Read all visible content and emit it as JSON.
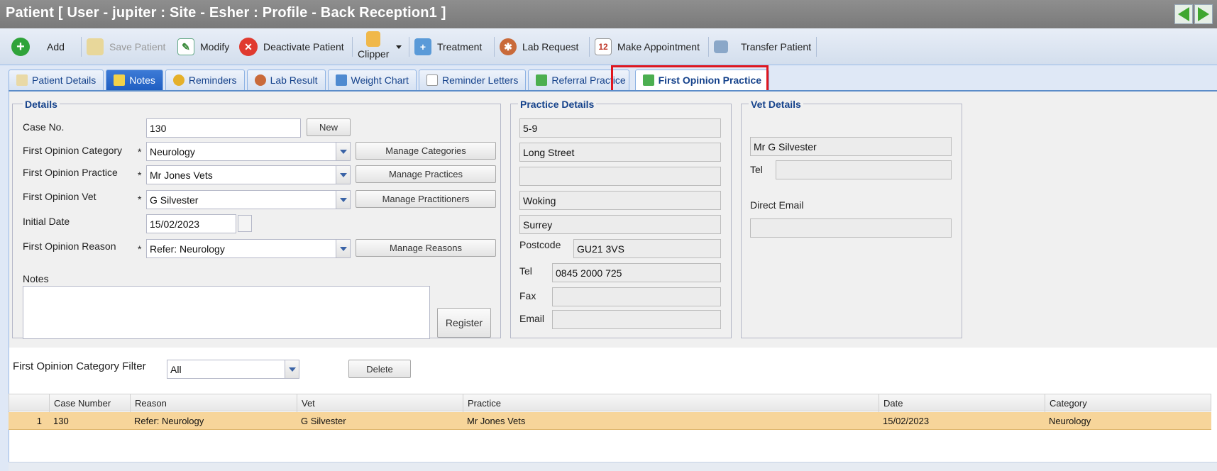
{
  "window": {
    "title": "Patient [ User - jupiter : Site - Esher : Profile - Back Reception1 ]"
  },
  "toolbar": {
    "add": "Add",
    "save": "Save Patient",
    "modify": "Modify",
    "deactivate": "Deactivate Patient",
    "clipper": "Clipper",
    "treatment": "Treatment",
    "lab_request": "Lab Request",
    "make_appointment": "Make Appointment",
    "calendar_day": "12",
    "transfer": "Transfer Patient"
  },
  "tabs": [
    "Patient Details",
    "Notes",
    "Reminders",
    "Lab Result",
    "Weight Chart",
    "Reminder Letters",
    "Referral Practice",
    "First Opinion Practice"
  ],
  "details": {
    "legend": "Details",
    "case_no_label": "Case No.",
    "case_no": "130",
    "new_button": "New",
    "category_label": "First Opinion Category",
    "category": "Neurology",
    "manage_categories": "Manage Categories",
    "practice_label": "First Opinion Practice",
    "practice": "Mr Jones Vets",
    "manage_practices": "Manage Practices",
    "vet_label": "First Opinion Vet",
    "vet": "G Silvester",
    "manage_practitioners": "Manage Practitioners",
    "initial_date_label": "Initial Date",
    "initial_date": "15/02/2023",
    "reason_label": "First Opinion Reason",
    "reason": "Refer: Neurology",
    "manage_reasons": "Manage Reasons",
    "notes_label": "Notes",
    "register_button": "Register",
    "required_mark": "*"
  },
  "practice_details": {
    "legend": "Practice Details",
    "line1": "5-9",
    "line2": "Long Street",
    "line3": "",
    "town": "Woking",
    "county": "Surrey",
    "postcode_label": "Postcode",
    "postcode": "GU21 3VS",
    "tel_label": "Tel",
    "tel": "0845 2000 725",
    "fax_label": "Fax",
    "fax": "",
    "email_label": "Email",
    "email": ""
  },
  "vet_details": {
    "legend": "Vet Details",
    "name": "Mr G Silvester",
    "tel_label": "Tel",
    "tel": "",
    "email_label": "Direct Email",
    "email": ""
  },
  "filter": {
    "label": "First Opinion Category Filter",
    "value": "All",
    "delete_button": "Delete"
  },
  "grid": {
    "columns": [
      "Case Number",
      "Reason",
      "Vet",
      "Practice",
      "Date",
      "Category"
    ],
    "rows": [
      {
        "num": "1",
        "case_number": "130",
        "reason": "Refer: Neurology",
        "vet": "G Silvester",
        "practice": "Mr Jones Vets",
        "date": "15/02/2023",
        "category": "Neurology"
      }
    ]
  }
}
